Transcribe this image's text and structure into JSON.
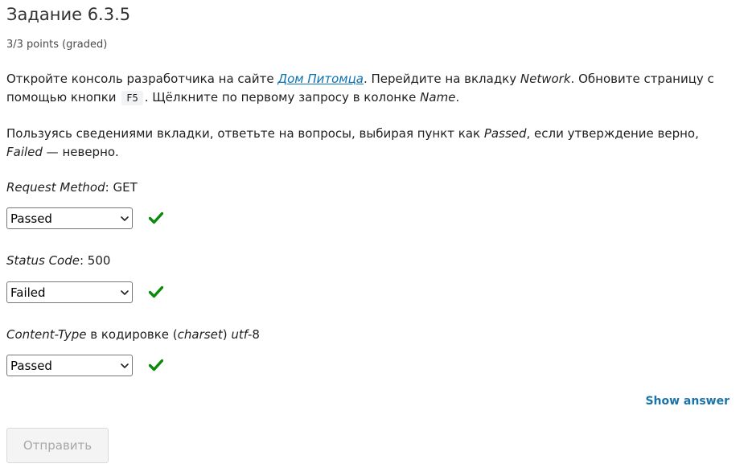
{
  "problem": {
    "title": "Задание 6.3.5",
    "points": "3/3 points (graded)"
  },
  "instructions": {
    "p1_part1": "Откройте консоль разработчика на сайте ",
    "p1_link": "Дом Питомца",
    "p1_part2": ". Перейдите на вкладку ",
    "p1_network": "Network",
    "p1_part3": ". Обновите страницу с помощью кнопки ",
    "p1_key": "F5",
    "p1_part4": ". Щёлкните по первому запросу в колонке ",
    "p1_name": "Name",
    "p1_part5": ".",
    "p2_part1": "Пользуясь сведениями вкладки, ответьте на вопросы, выбирая пункт как ",
    "p2_passed": "Passed",
    "p2_part2": ", если утверждение верно, ",
    "p2_failed": "Failed",
    "p2_part3": " — неверно."
  },
  "questions": [
    {
      "label_em": "Request Method",
      "label_rest": ": GET",
      "selected": "Passed",
      "status": "correct"
    },
    {
      "label_em": "Status Code",
      "label_rest": ": 500",
      "selected": "Failed",
      "status": "correct"
    },
    {
      "label_em": "Content-Type",
      "label_mid": " в кодировке (",
      "label_em2": "charset",
      "label_mid2": ") ",
      "label_em3": "utf",
      "label_rest": "-8",
      "selected": "Passed",
      "status": "correct"
    }
  ],
  "actions": {
    "show_answer": "Show answer",
    "submit": "Отправить"
  },
  "colors": {
    "check": "#0b8a0b",
    "link": "#0a72b4",
    "show_answer": "#1a73a8"
  },
  "icons": {
    "check": "checkmark-icon",
    "dropdown": "chevron-down-icon"
  }
}
